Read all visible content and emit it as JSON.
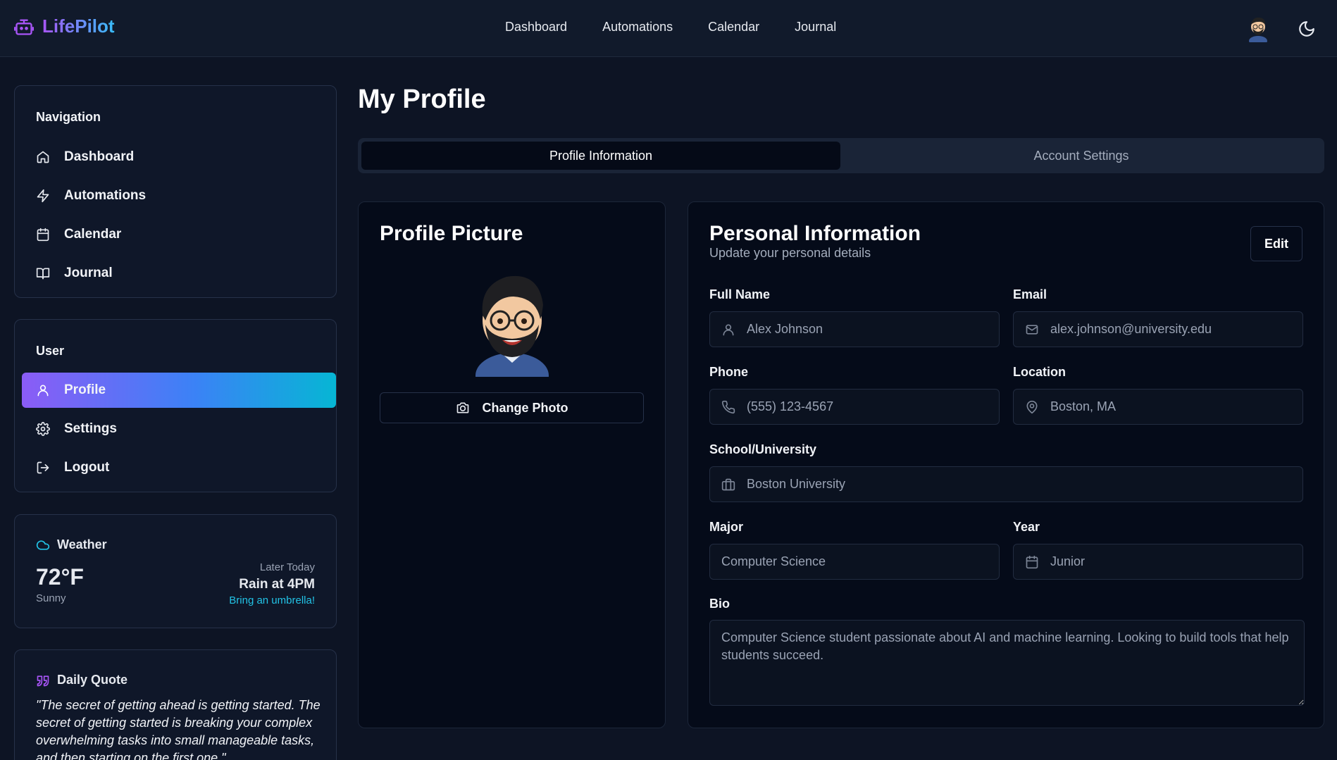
{
  "app": {
    "name": "LifePilot",
    "accent": "#8b5cf6",
    "accent2": "#06b6d4"
  },
  "topnav": [
    {
      "label": "Dashboard"
    },
    {
      "label": "Automations"
    },
    {
      "label": "Calendar"
    },
    {
      "label": "Journal"
    }
  ],
  "sidebar": {
    "navigation_heading": "Navigation",
    "navigation": [
      {
        "label": "Dashboard",
        "icon": "home-icon"
      },
      {
        "label": "Automations",
        "icon": "zap-icon"
      },
      {
        "label": "Calendar",
        "icon": "calendar-icon"
      },
      {
        "label": "Journal",
        "icon": "book-icon"
      }
    ],
    "user_heading": "User",
    "user": [
      {
        "label": "Profile",
        "icon": "user-icon",
        "active": true
      },
      {
        "label": "Settings",
        "icon": "gear-icon"
      },
      {
        "label": "Logout",
        "icon": "logout-icon"
      }
    ]
  },
  "weather": {
    "title": "Weather",
    "temp": "72°F",
    "condition": "Sunny",
    "later_label": "Later Today",
    "forecast": "Rain at 4PM",
    "tip": "Bring an umbrella!"
  },
  "quote": {
    "title": "Daily Quote",
    "text": "\"The secret of getting ahead is getting started. The secret of getting started is breaking your complex overwhelming tasks into small manageable tasks, and then starting on the first one.\""
  },
  "main": {
    "title": "My Profile",
    "tabs": [
      {
        "label": "Profile Information",
        "active": true
      },
      {
        "label": "Account Settings"
      }
    ]
  },
  "profile_picture": {
    "title": "Profile Picture",
    "button": "Change Photo"
  },
  "personal": {
    "title": "Personal Information",
    "subtitle": "Update your personal details",
    "edit_button": "Edit",
    "fields": {
      "full_name": {
        "label": "Full Name",
        "value": "Alex Johnson"
      },
      "email": {
        "label": "Email",
        "value": "alex.johnson@university.edu"
      },
      "phone": {
        "label": "Phone",
        "value": "(555) 123-4567"
      },
      "location": {
        "label": "Location",
        "value": "Boston, MA"
      },
      "school": {
        "label": "School/University",
        "value": "Boston University"
      },
      "major": {
        "label": "Major",
        "value": "Computer Science"
      },
      "year": {
        "label": "Year",
        "value": "Junior"
      },
      "bio": {
        "label": "Bio",
        "value": "Computer Science student passionate about AI and machine learning. Looking to build tools that help students succeed."
      }
    }
  }
}
